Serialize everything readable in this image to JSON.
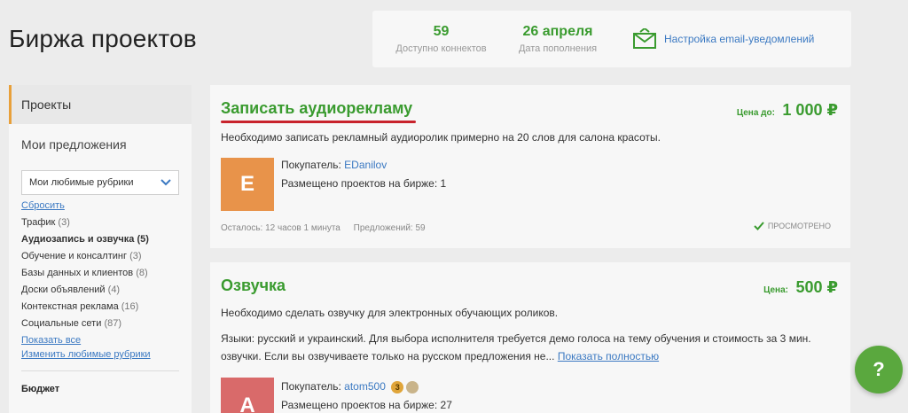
{
  "page": {
    "title": "Биржа проектов"
  },
  "stats": {
    "connects": {
      "value": "59",
      "label": "Доступно коннектов"
    },
    "refill": {
      "value": "26 апреля",
      "label": "Дата пополнения"
    },
    "email_settings": {
      "label": "Настройка email-уведомлений",
      "icon": "envelope-icon"
    }
  },
  "sidebar": {
    "tabs": [
      {
        "label": "Проекты"
      },
      {
        "label": "Мои предложения"
      }
    ],
    "rubric_select": {
      "selected": "Мои любимые рубрики"
    },
    "reset_label": "Сбросить",
    "categories": [
      {
        "name": "Трафик",
        "count": "(3)"
      },
      {
        "name": "Аудиозапись и озвучка",
        "count": "(5)"
      },
      {
        "name": "Обучение и консалтинг",
        "count": "(3)"
      },
      {
        "name": "Базы данных и клиентов",
        "count": "(8)"
      },
      {
        "name": "Доски объявлений",
        "count": "(4)"
      },
      {
        "name": "Контекстная реклама",
        "count": "(16)"
      },
      {
        "name": "Социальные сети",
        "count": "(87)"
      }
    ],
    "show_all_label": "Показать все",
    "change_rubrics_label": "Изменить любимые рубрики",
    "budget_title": "Бюджет"
  },
  "projects": [
    {
      "title": "Записать аудиорекламу",
      "price_label": "Цена до:",
      "price": "1 000 ₽",
      "description": "Необходимо записать рекламный аудиоролик примерно на 20 слов для салона красоты.",
      "avatar_letter": "E",
      "buyer_label": "Покупатель:",
      "buyer_name": "EDanilov",
      "placed_label": "Размещено проектов на бирже: 1",
      "time_left": "Осталось: 12 часов 1 минута",
      "offers": "Предложений: 59",
      "viewed": "ПРОСМОТРЕНО"
    },
    {
      "title": "Озвучка",
      "price_label": "Цена:",
      "price": "500 ₽",
      "description": "Необходимо сделать озвучку для электронных обучающих роликов.",
      "languages": "Языки: русский и украинский. Для выбора исполнителя требуется демо голоса на тему обучения и стоимость за 3 мин. озвучки. Если вы озвучиваете только на русском предложения не...",
      "show_full": "Показать полностью",
      "avatar_letter": "A",
      "buyer_label": "Покупатель:",
      "buyer_name": "atom500",
      "badge_number": "3",
      "placed_label": "Размещено проектов на бирже: 27"
    }
  ],
  "help": {
    "label": "?"
  },
  "colors": {
    "accent_green": "#3a9b2f",
    "link_blue": "#3b79c2",
    "underline_red": "#c8232c",
    "tab_marker": "#e8a03a"
  }
}
